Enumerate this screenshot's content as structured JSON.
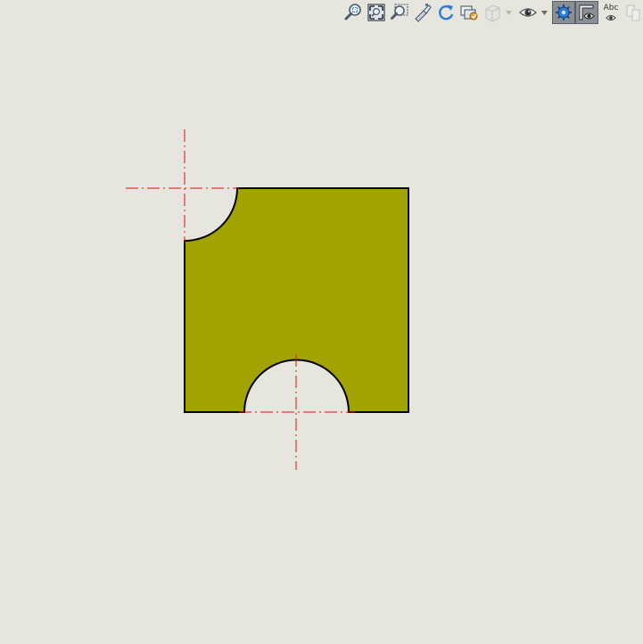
{
  "toolbar": {
    "items": [
      {
        "name": "zoom-selection-icon",
        "state": "normal"
      },
      {
        "name": "zoom-fit-icon",
        "state": "normal"
      },
      {
        "name": "zoom-area-icon",
        "state": "normal"
      },
      {
        "name": "previous-view-icon",
        "state": "normal"
      },
      {
        "name": "rotate-view-icon",
        "state": "normal"
      },
      {
        "name": "section-view-icon",
        "state": "normal"
      },
      {
        "name": "view-orientation-icon",
        "state": "disabled"
      },
      {
        "name": "hide-show-items-icon",
        "state": "normal"
      },
      {
        "name": "display-style-icon",
        "state": "active"
      },
      {
        "name": "view-settings-icon",
        "state": "active"
      },
      {
        "name": "annotation-visibility-icon",
        "state": "normal"
      },
      {
        "name": "apply-scene-icon",
        "state": "disabled"
      }
    ],
    "annotation_label": "Abc"
  },
  "colors": {
    "background": "#e7e6de",
    "face_fill": "#a3a300",
    "outline": "#000000",
    "centerline": "#e01010",
    "active_button": "#8a8f96"
  }
}
